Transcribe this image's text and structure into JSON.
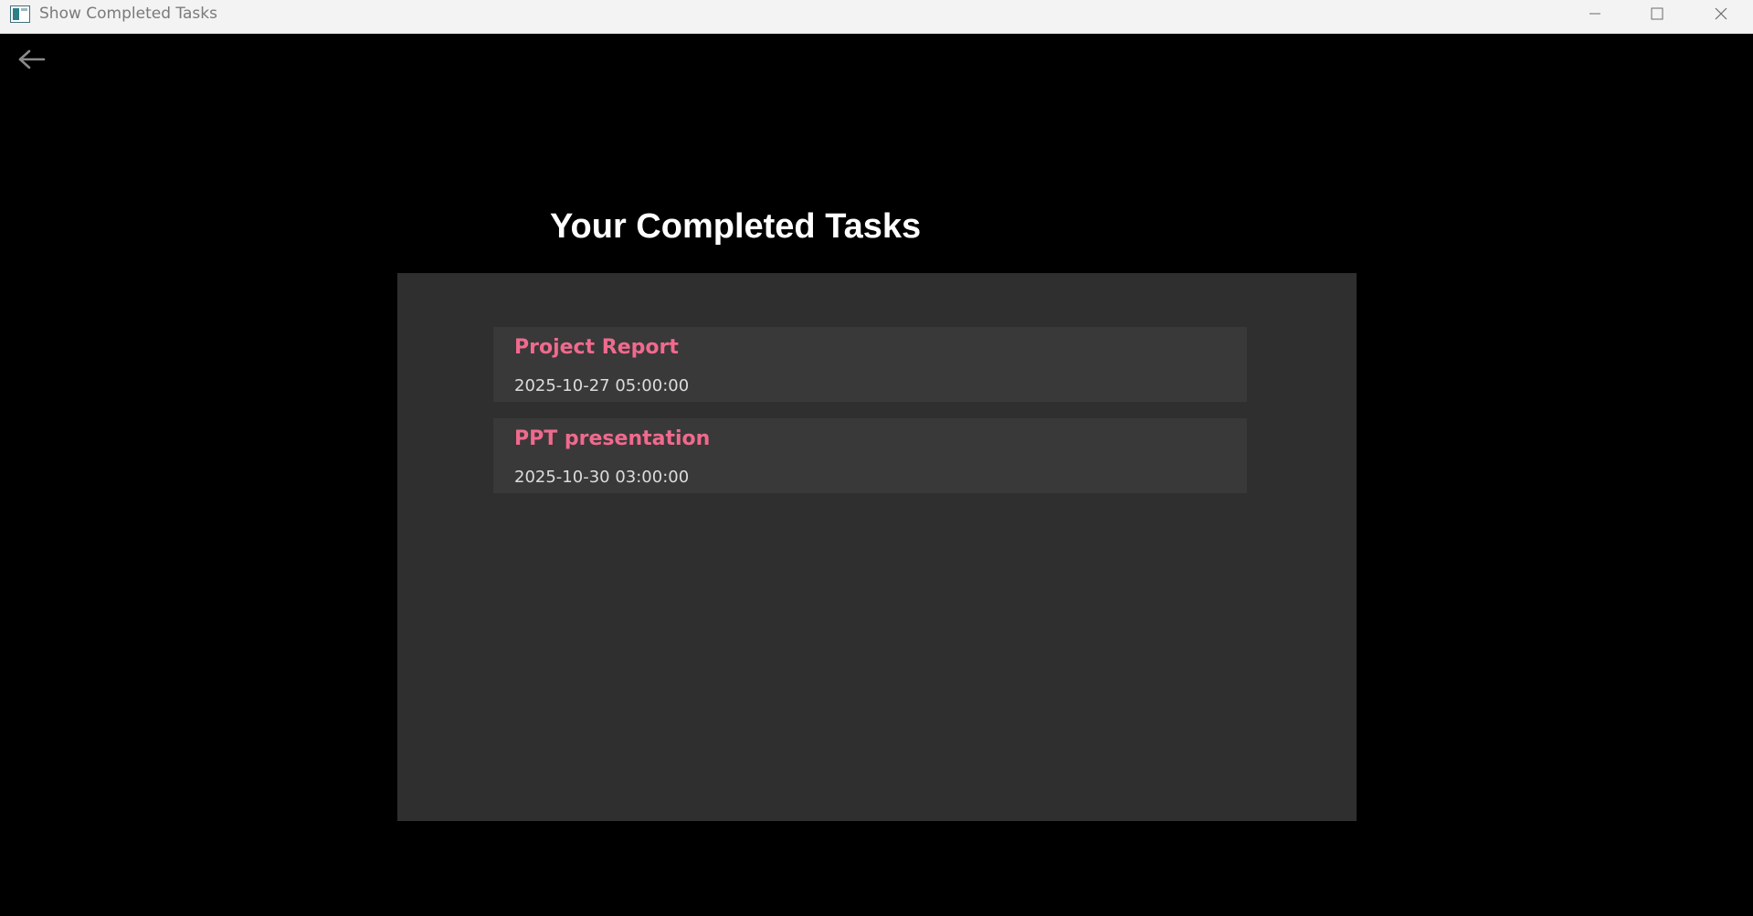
{
  "window": {
    "title": "Show Completed Tasks",
    "controls": {
      "minimize_icon": "minimize-icon",
      "maximize_icon": "maximize-icon",
      "close_icon": "close-icon"
    }
  },
  "navigation": {
    "back_icon": "arrow-left-icon"
  },
  "page": {
    "title": "Your Completed Tasks"
  },
  "tasks": [
    {
      "name": "Project Report",
      "datetime": "2025-10-27 05:00:00"
    },
    {
      "name": "PPT presentation",
      "datetime": "2025-10-30 03:00:00"
    }
  ],
  "colors": {
    "background": "#000000",
    "panel": "#2f2f2f",
    "card": "#393939",
    "task_name": "#f06a8e",
    "task_date": "#dcdcdc",
    "title_text": "#ffffff",
    "titlebar": "#f3f3f3"
  }
}
